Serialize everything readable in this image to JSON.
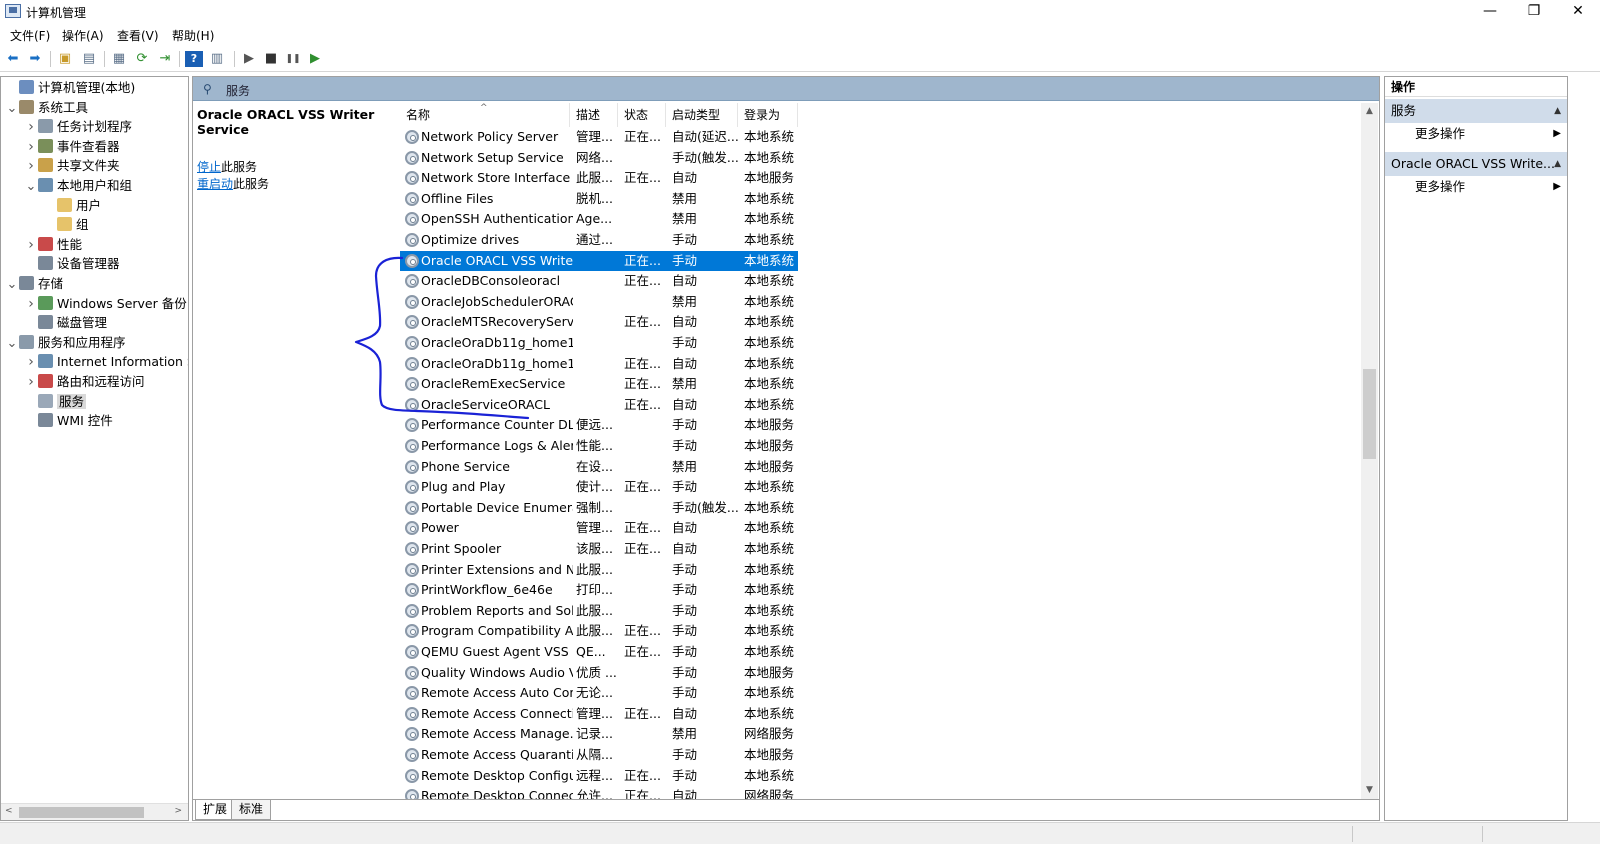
{
  "window": {
    "title": "计算机管理",
    "minimize": "—",
    "restore": "❐",
    "close": "✕"
  },
  "menu": [
    "文件(F)",
    "操作(A)",
    "查看(V)",
    "帮助(H)"
  ],
  "toolbar": [
    {
      "icon": "back-arrow-icon",
      "glyph": "⬅",
      "color": "#1a6fc4"
    },
    {
      "icon": "forward-arrow-icon",
      "glyph": "➡",
      "color": "#1a6fc4"
    },
    {
      "icon": "up-folder-icon",
      "glyph": "▣",
      "color": "#c79a2b"
    },
    {
      "icon": "show-hide-tree-icon",
      "glyph": "▤",
      "color": "#5a6f88"
    },
    {
      "icon": "properties-icon",
      "glyph": "▦",
      "color": "#5a6f88"
    },
    {
      "icon": "refresh-icon",
      "glyph": "⟳",
      "color": "#2f8f2f"
    },
    {
      "icon": "export-list-icon",
      "glyph": "⇥",
      "color": "#2f8f2f"
    },
    {
      "icon": "help-icon",
      "glyph": "?",
      "color": "#ffffff"
    },
    {
      "icon": "show-hide-action-pane-icon",
      "glyph": "▥",
      "color": "#5a6f88"
    },
    {
      "icon": "start-service-icon",
      "glyph": "▶",
      "color": "#555555"
    },
    {
      "icon": "stop-service-icon",
      "glyph": "■",
      "color": "#333333"
    },
    {
      "icon": "pause-service-icon",
      "glyph": "❚❚",
      "color": "#555555"
    },
    {
      "icon": "restart-service-icon",
      "glyph": "▶",
      "color": "#2f8f2f"
    }
  ],
  "tree": [
    {
      "label": "计算机管理(本地)",
      "level": 0,
      "arrow": "",
      "icon": "computer-management-icon",
      "color": "#6c8ebf"
    },
    {
      "label": "系统工具",
      "level": 0,
      "arrow": "v",
      "icon": "system-tools-icon",
      "color": "#9a8a6a"
    },
    {
      "label": "任务计划程序",
      "level": 1,
      "arrow": ">",
      "icon": "clock-icon",
      "color": "#8a9aaa"
    },
    {
      "label": "事件查看器",
      "level": 1,
      "arrow": ">",
      "icon": "event-viewer-icon",
      "color": "#7a8f5a"
    },
    {
      "label": "共享文件夹",
      "level": 1,
      "arrow": ">",
      "icon": "shared-folder-icon",
      "color": "#c9a14a"
    },
    {
      "label": "本地用户和组",
      "level": 1,
      "arrow": "v",
      "icon": "users-icon",
      "color": "#6a8fb0"
    },
    {
      "label": "用户",
      "level": 2,
      "arrow": "",
      "icon": "folder-icon",
      "color": "#e6c36a"
    },
    {
      "label": "组",
      "level": 2,
      "arrow": "",
      "icon": "folder-icon",
      "color": "#e6c36a"
    },
    {
      "label": "性能",
      "level": 1,
      "arrow": ">",
      "icon": "performance-icon",
      "color": "#c94a4a"
    },
    {
      "label": "设备管理器",
      "level": 1,
      "arrow": "",
      "icon": "device-manager-icon",
      "color": "#7a8898"
    },
    {
      "label": "存储",
      "level": 0,
      "arrow": "v",
      "icon": "storage-icon",
      "color": "#7a8898"
    },
    {
      "label": "Windows Server 备份",
      "level": 1,
      "arrow": ">",
      "icon": "backup-icon",
      "color": "#5a9a5a"
    },
    {
      "label": "磁盘管理",
      "level": 1,
      "arrow": "",
      "icon": "disk-management-icon",
      "color": "#7a8898"
    },
    {
      "label": "服务和应用程序",
      "level": 0,
      "arrow": "v",
      "icon": "services-apps-icon",
      "color": "#8a9aaa"
    },
    {
      "label": "Internet Information S",
      "level": 1,
      "arrow": ">",
      "icon": "iis-icon",
      "color": "#6a8fb0"
    },
    {
      "label": "路由和远程访问",
      "level": 1,
      "arrow": ">",
      "icon": "routing-icon",
      "color": "#c94a4a"
    },
    {
      "label": "服务",
      "level": 1,
      "arrow": "",
      "icon": "services-gear-icon",
      "color": "#9aa8b8",
      "selected": true
    },
    {
      "label": "WMI 控件",
      "level": 1,
      "arrow": "",
      "icon": "wmi-icon",
      "color": "#7a8898"
    }
  ],
  "center": {
    "header": "服务",
    "selected_service": "Oracle ORACL VSS Writer Service",
    "actions": [
      {
        "link": "停止",
        "rest": "此服务"
      },
      {
        "link": "重启动",
        "rest": "此服务"
      }
    ],
    "columns": [
      "名称",
      "描述",
      "状态",
      "启动类型",
      "登录为"
    ],
    "rows": [
      {
        "name": "Network Policy Server",
        "desc": "管理...",
        "status": "正在...",
        "startup": "自动(延迟...",
        "logon": "本地系统"
      },
      {
        "name": "Network Setup Service",
        "desc": "网络...",
        "status": "",
        "startup": "手动(触发...",
        "logon": "本地系统"
      },
      {
        "name": "Network Store Interface ...",
        "desc": "此服...",
        "status": "正在...",
        "startup": "自动",
        "logon": "本地服务"
      },
      {
        "name": "Offline Files",
        "desc": "脱机...",
        "status": "",
        "startup": "禁用",
        "logon": "本地系统"
      },
      {
        "name": "OpenSSH Authentication ...",
        "desc": "Age...",
        "status": "",
        "startup": "禁用",
        "logon": "本地系统"
      },
      {
        "name": "Optimize drives",
        "desc": "通过...",
        "status": "",
        "startup": "手动",
        "logon": "本地系统"
      },
      {
        "name": "Oracle ORACL VSS Write...",
        "desc": "",
        "status": "正在...",
        "startup": "手动",
        "logon": "本地系统",
        "selected": true
      },
      {
        "name": "OracleDBConsoleoracl",
        "desc": "",
        "status": "正在...",
        "startup": "自动",
        "logon": "本地系统"
      },
      {
        "name": "OracleJobSchedulerORACL",
        "desc": "",
        "status": "",
        "startup": "禁用",
        "logon": "本地系统"
      },
      {
        "name": "OracleMTSRecoveryServi...",
        "desc": "",
        "status": "正在...",
        "startup": "自动",
        "logon": "本地系统"
      },
      {
        "name": "OracleOraDb11g_home1...",
        "desc": "",
        "status": "",
        "startup": "手动",
        "logon": "本地系统"
      },
      {
        "name": "OracleOraDb11g_home1...",
        "desc": "",
        "status": "正在...",
        "startup": "自动",
        "logon": "本地系统"
      },
      {
        "name": "OracleRemExecService",
        "desc": "",
        "status": "正在...",
        "startup": "禁用",
        "logon": "本地系统"
      },
      {
        "name": "OracleServiceORACL",
        "desc": "",
        "status": "正在...",
        "startup": "自动",
        "logon": "本地系统"
      },
      {
        "name": "Performance Counter DL...",
        "desc": "便远...",
        "status": "",
        "startup": "手动",
        "logon": "本地服务"
      },
      {
        "name": "Performance Logs & Aler...",
        "desc": "性能...",
        "status": "",
        "startup": "手动",
        "logon": "本地服务"
      },
      {
        "name": "Phone Service",
        "desc": "在设...",
        "status": "",
        "startup": "禁用",
        "logon": "本地服务"
      },
      {
        "name": "Plug and Play",
        "desc": "使计...",
        "status": "正在...",
        "startup": "手动",
        "logon": "本地系统"
      },
      {
        "name": "Portable Device Enumera...",
        "desc": "强制...",
        "status": "",
        "startup": "手动(触发...",
        "logon": "本地系统"
      },
      {
        "name": "Power",
        "desc": "管理...",
        "status": "正在...",
        "startup": "自动",
        "logon": "本地系统"
      },
      {
        "name": "Print Spooler",
        "desc": "该服...",
        "status": "正在...",
        "startup": "自动",
        "logon": "本地系统"
      },
      {
        "name": "Printer Extensions and N...",
        "desc": "此服...",
        "status": "",
        "startup": "手动",
        "logon": "本地系统"
      },
      {
        "name": "PrintWorkflow_6e46e",
        "desc": "打印...",
        "status": "",
        "startup": "手动",
        "logon": "本地系统"
      },
      {
        "name": "Problem Reports and Sol...",
        "desc": "此服...",
        "status": "",
        "startup": "手动",
        "logon": "本地系统"
      },
      {
        "name": "Program Compatibility A...",
        "desc": "此服...",
        "status": "正在...",
        "startup": "手动",
        "logon": "本地系统"
      },
      {
        "name": "QEMU Guest Agent VSS ...",
        "desc": "QE...",
        "status": "正在...",
        "startup": "手动",
        "logon": "本地系统"
      },
      {
        "name": "Quality Windows Audio V...",
        "desc": "优质 ...",
        "status": "",
        "startup": "手动",
        "logon": "本地服务"
      },
      {
        "name": "Remote Access Auto Con...",
        "desc": "无论...",
        "status": "",
        "startup": "手动",
        "logon": "本地系统"
      },
      {
        "name": "Remote Access Connecti...",
        "desc": "管理...",
        "status": "正在...",
        "startup": "自动",
        "logon": "本地系统"
      },
      {
        "name": "Remote Access Manage...",
        "desc": "记录...",
        "status": "",
        "startup": "禁用",
        "logon": "网络服务"
      },
      {
        "name": "Remote Access Quaranti...",
        "desc": "从隔...",
        "status": "",
        "startup": "手动",
        "logon": "本地服务"
      },
      {
        "name": "Remote Desktop Configu...",
        "desc": "远程...",
        "status": "正在...",
        "startup": "手动",
        "logon": "本地系统"
      },
      {
        "name": "Remote Desktop Connec...",
        "desc": "允许...",
        "status": "正在...",
        "startup": "自动",
        "logon": "网络服务"
      }
    ],
    "tabs": [
      "扩展",
      "标准"
    ],
    "annotation_color": "#1a22d6"
  },
  "actions_pane": {
    "title": "操作",
    "groups": [
      {
        "label": "服务",
        "item": "更多操作"
      },
      {
        "label": "Oracle ORACL VSS Write...",
        "item": "更多操作"
      }
    ]
  },
  "colors": {
    "selection": "#0078d7",
    "header": "#9fb6cd",
    "action_group": "#d0dcea",
    "link": "#0066cc"
  }
}
